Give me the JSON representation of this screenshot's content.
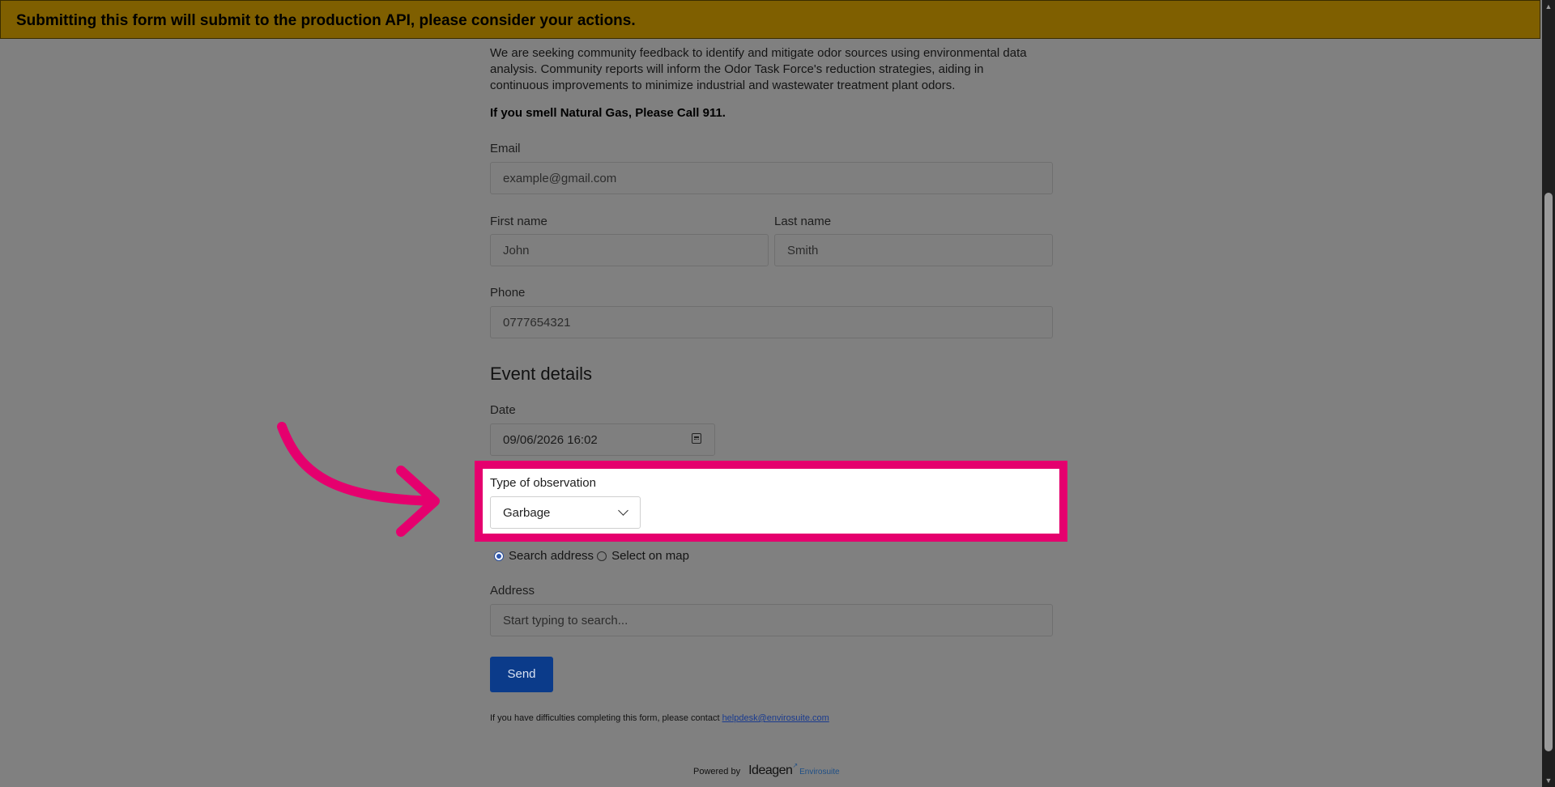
{
  "banner": {
    "text": "Submitting this form will submit to the production API, please consider your actions."
  },
  "intro": {
    "line1": "We are seeking community feedback to identify and mitigate odor sources using environmental data",
    "line2": "analysis. Community reports will inform the Odor Task Force's reduction strategies, aiding in",
    "line3": "continuous improvements to minimize industrial and wastewater treatment plant odors.",
    "warning": "If you smell Natural Gas, Please Call 911."
  },
  "fields": {
    "email_label": "Email",
    "email_placeholder": "example@gmail.com",
    "first_name_label": "First name",
    "first_name_placeholder": "John",
    "last_name_label": "Last name",
    "last_name_placeholder": "Smith",
    "phone_label": "Phone",
    "phone_placeholder": "0777654321"
  },
  "event": {
    "title": "Event details",
    "date_label": "Date",
    "date_value": "09/06/2026 16:02",
    "type_label": "Type of observation",
    "type_value": "Garbage",
    "radio_search": "Search address",
    "radio_map": "Select on map",
    "address_label": "Address",
    "address_placeholder": "Start typing to search..."
  },
  "actions": {
    "send": "Send"
  },
  "footer": {
    "help_text": "If you have difficulties completing this form, please contact ",
    "help_link": "helpdesk@envirosuite.com",
    "powered_by": "Powered by",
    "brand_main": "Ideagen",
    "brand_sub": "Envirosuite"
  },
  "colors": {
    "highlight": "#e5006e",
    "banner": "#7f5f00",
    "send_button": "#0b3b8a"
  }
}
